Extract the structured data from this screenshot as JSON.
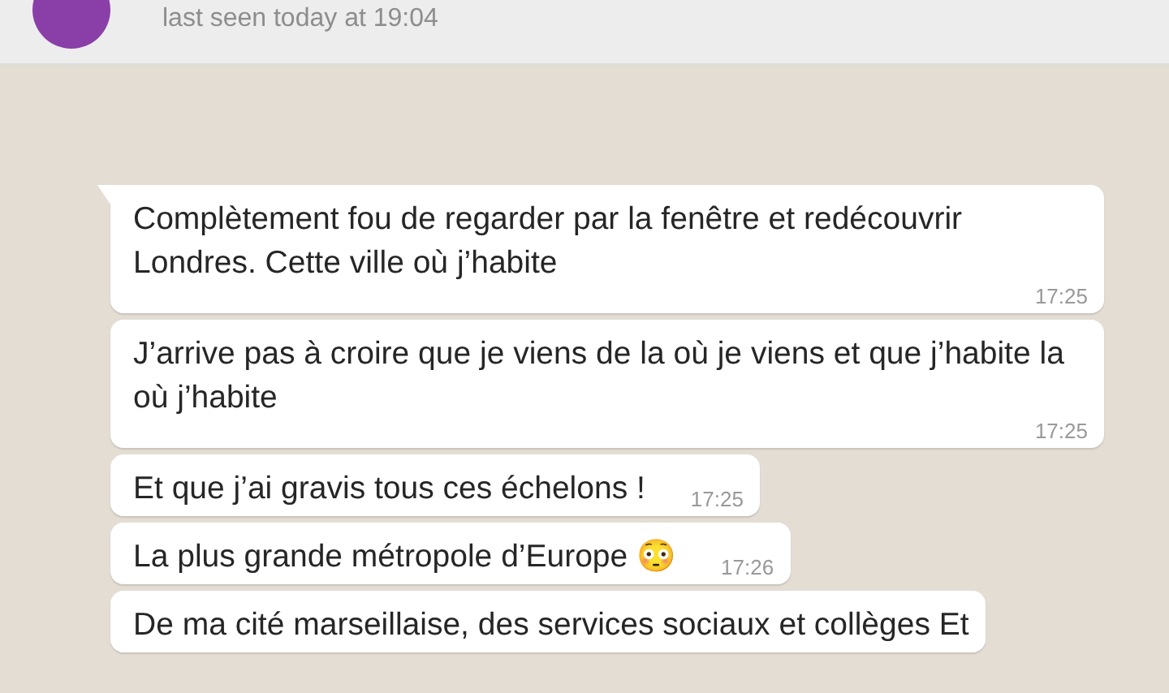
{
  "header": {
    "status": "last seen today at 19:04"
  },
  "messages": [
    {
      "text": "Complètement fou de regarder par la fenêtre et redécouvrir Londres. Cette ville où j’habite",
      "time": "17:25",
      "tail": true
    },
    {
      "text": "J’arrive pas à croire que je viens de la où je viens et que j’habite la où j’habite",
      "time": "17:25",
      "tail": false
    },
    {
      "text": "Et que j’ai gravis tous ces échelons !",
      "time": "17:25",
      "tail": false
    },
    {
      "text": "La plus grande métropole d’Europe 😳",
      "time": "17:26",
      "tail": false
    },
    {
      "text": "De ma cité marseillaise, des services sociaux et collèges Et",
      "tail": false
    }
  ]
}
